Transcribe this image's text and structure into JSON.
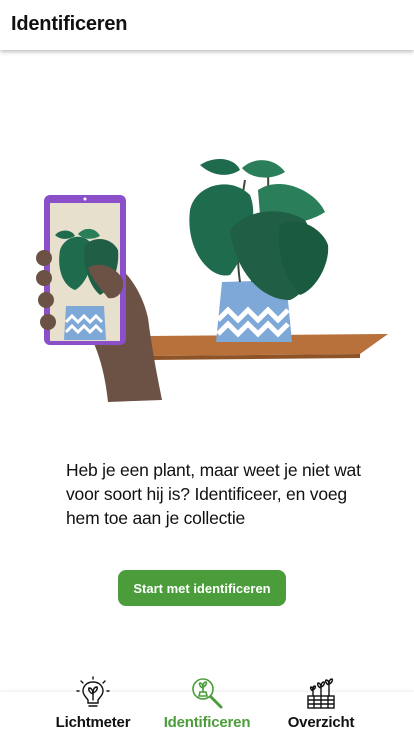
{
  "header": {
    "title": "Identificeren"
  },
  "main": {
    "intro_text": "Heb je een plant, maar weet je niet wat voor soort hij is? Identificeer, en voeg hem toe aan je collectie",
    "cta_label": "Start met identificeren"
  },
  "colors": {
    "accent": "#4a9d3a",
    "leaf_dark": "#1f6b4e",
    "leaf": "#2a7f5a",
    "pot": "#7ea8d8",
    "shelf": "#b8713b",
    "phone_frame": "#8a4fc9",
    "hand": "#6b5244"
  },
  "bottom_nav": {
    "items": [
      {
        "label": "Lichtmeter",
        "icon": "lightbulb-plant-icon",
        "active": false
      },
      {
        "label": "Identificeren",
        "icon": "magnifier-plant-icon",
        "active": true
      },
      {
        "label": "Overzicht",
        "icon": "plants-tray-icon",
        "active": false
      }
    ]
  }
}
